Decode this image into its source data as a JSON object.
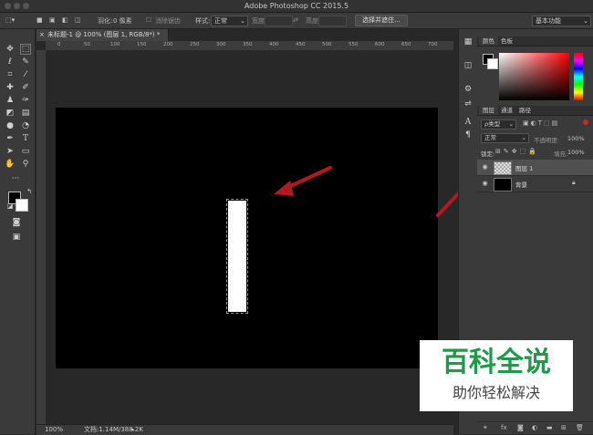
{
  "app": {
    "title": "Adobe Photoshop CC 2015.5"
  },
  "options_bar": {
    "feather_label": "羽化:",
    "feather_value": "0 像素",
    "antialias_label": "消除锯齿",
    "style_label": "样式:",
    "style_value": "正常",
    "width_label": "宽度:",
    "height_label": "高度:",
    "select_mask_button": "选择并遮住...",
    "workspace": "基本功能"
  },
  "document": {
    "tab_title": "未标题-1 @ 100% (图层 1, RGB/8*) *",
    "ruler_labels": [
      "0",
      "50",
      "100",
      "150",
      "200",
      "250",
      "300",
      "350",
      "400",
      "450",
      "500",
      "550",
      "600",
      "650",
      "700"
    ],
    "zoom": "100%",
    "doc_info": "文档:1.14M/388.2K"
  },
  "color_panel": {
    "tabs": [
      "颜色",
      "色板"
    ]
  },
  "layers_panel": {
    "tabs": [
      "图层",
      "通道",
      "路径"
    ],
    "filter_kind": "ρ类型",
    "blend_mode": "正常",
    "opacity_label": "不透明度:",
    "opacity_value": "100%",
    "lock_label": "锁定:",
    "fill_label": "填充:",
    "fill_value": "100%",
    "layers": [
      {
        "name": "图层 1",
        "selected": true
      },
      {
        "name": "背景",
        "locked": true
      }
    ]
  },
  "watermark": {
    "title": "百科全说",
    "subtitle": "助你轻松解决"
  },
  "colors": {
    "accent_red": "#b3191f",
    "watermark_green": "#1f9a4a",
    "canvas": "#000000"
  }
}
